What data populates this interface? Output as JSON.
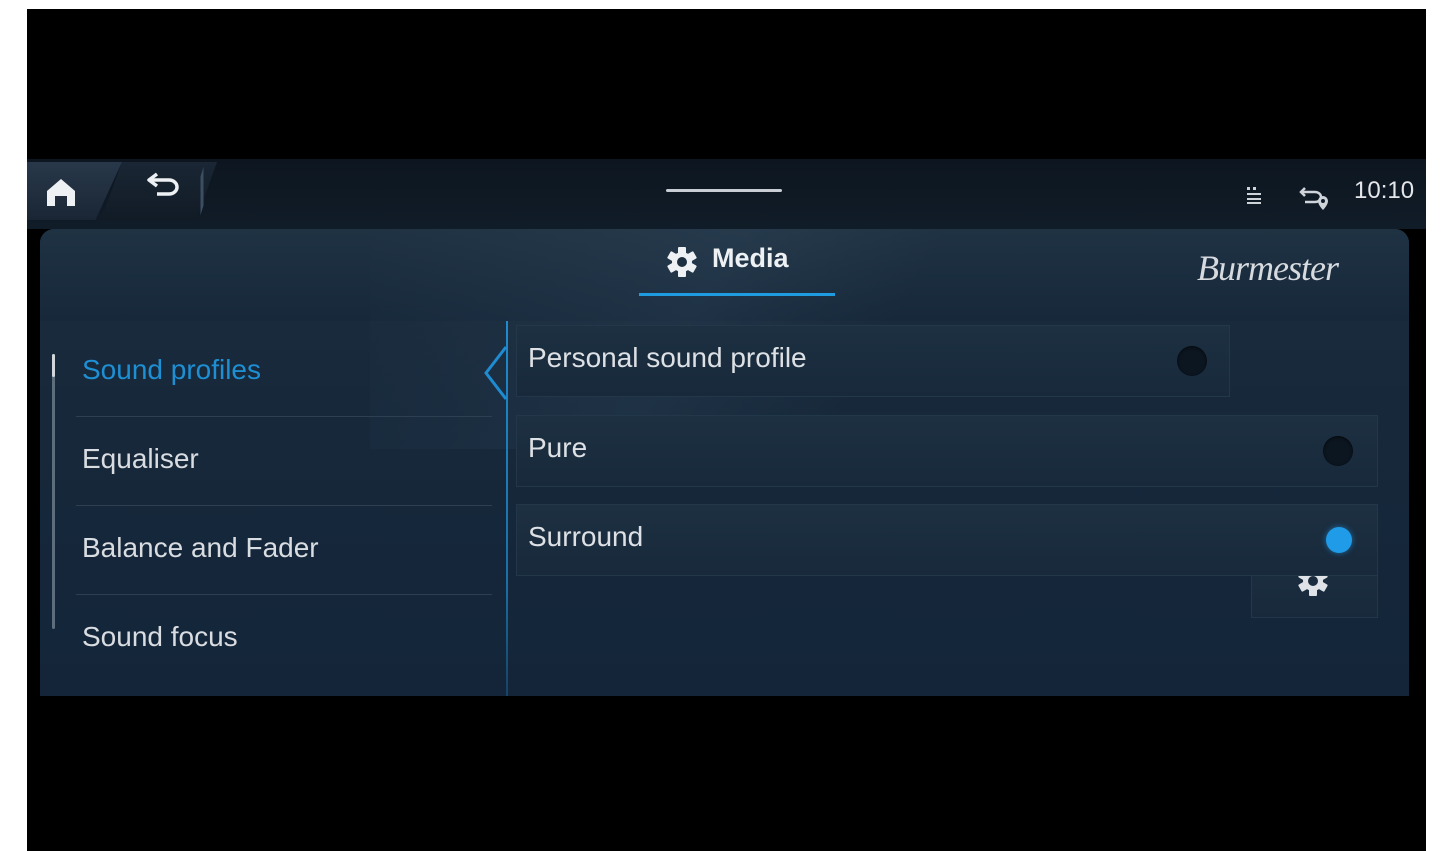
{
  "status_bar": {
    "home_icon": "home-icon",
    "back_icon": "back-arrow-icon",
    "status_icons": [
      "connectivity-icon",
      "navigation-icon"
    ],
    "time": "10:10"
  },
  "header": {
    "tab_icon": "gear-icon",
    "tab_label": "Media",
    "brand": "Burmester"
  },
  "menu": {
    "items": [
      {
        "label": "Sound profiles",
        "active": true
      },
      {
        "label": "Equaliser",
        "active": false
      },
      {
        "label": "Balance and Fader",
        "active": false
      },
      {
        "label": "Sound focus",
        "active": false
      }
    ]
  },
  "options": {
    "items": [
      {
        "label": "Personal sound profile",
        "selected": false
      },
      {
        "label": "Pure",
        "selected": false
      },
      {
        "label": "Surround",
        "selected": true
      }
    ],
    "settings_icon": "gear-icon"
  },
  "colors": {
    "accent": "#1f9be8",
    "panel": "#17293b",
    "background": "#000000"
  }
}
